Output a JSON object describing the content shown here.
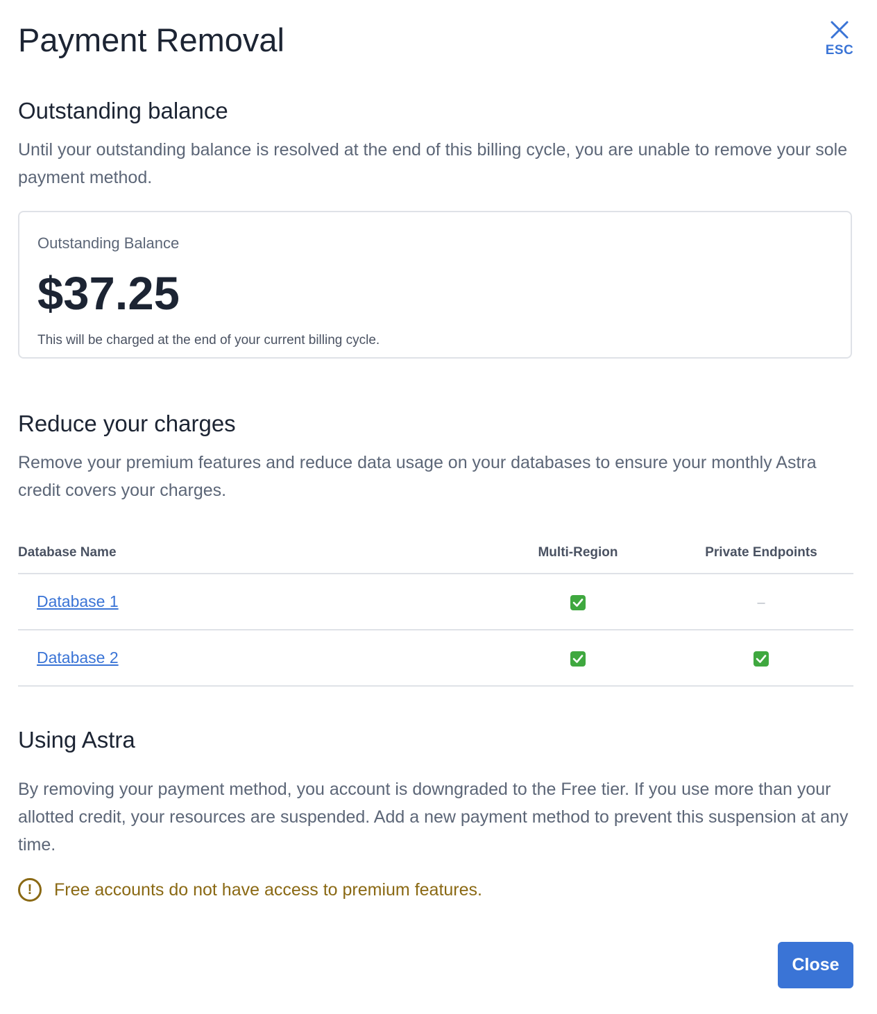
{
  "modal": {
    "title": "Payment Removal",
    "esc_label": "ESC"
  },
  "outstanding": {
    "heading": "Outstanding balance",
    "description": "Until your outstanding balance is resolved at the end of this billing cycle, you are unable to remove your sole payment method.",
    "card": {
      "label": "Outstanding Balance",
      "amount": "$37.25",
      "note": "This will be charged at the end of your current billing cycle."
    }
  },
  "reduce": {
    "heading": "Reduce your charges",
    "description": "Remove your premium features and reduce data usage on your databases to ensure your monthly Astra credit covers your charges.",
    "table": {
      "columns": [
        "Database Name",
        "Multi-Region",
        "Private Endpoints"
      ],
      "rows": [
        {
          "name": "Database 1",
          "multi_region": true,
          "private_endpoints": false,
          "empty_mark": "–"
        },
        {
          "name": "Database 2",
          "multi_region": true,
          "private_endpoints": true
        }
      ]
    }
  },
  "using": {
    "heading": "Using Astra",
    "description": "By  removing your payment method, you account is downgraded to the Free tier. If you use more than your allotted credit, your resources are suspended. Add a new payment method to prevent this suspension at any time.",
    "warning": {
      "icon": "exclamation-circle-icon",
      "text": "Free accounts do not have access to premium features."
    }
  },
  "footer": {
    "close_label": "Close"
  },
  "colors": {
    "accent": "#3a74d6",
    "warning": "#8a6914",
    "check": "#3fa83f"
  }
}
